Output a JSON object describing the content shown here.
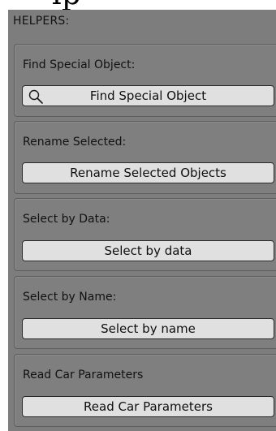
{
  "top_text": "lp",
  "panel": {
    "title": "HELPERS:"
  },
  "groups": [
    {
      "label": "Find Special Object:",
      "button_label": "Find Special Object",
      "button_icon": "search-icon"
    },
    {
      "label": "Rename Selected:",
      "button_label": "Rename Selected Objects"
    },
    {
      "label": "Select by Data:",
      "button_label": "Select by data"
    },
    {
      "label": "Select by Name:",
      "button_label": "Select by name"
    },
    {
      "label": "Read Car Parameters",
      "button_label": "Read Car Parameters"
    }
  ],
  "colors": {
    "panel_bg": "#7d7d7d",
    "button_bg": "#e0e0e0",
    "border": "#2a2a2a"
  }
}
